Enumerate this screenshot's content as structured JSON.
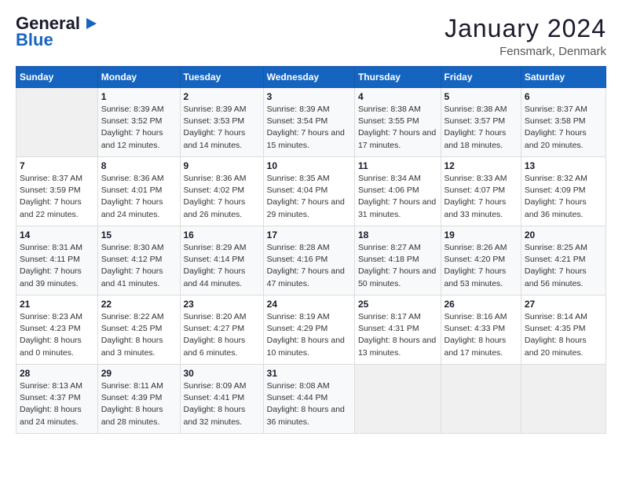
{
  "header": {
    "logo_line1": "General",
    "logo_line2": "Blue",
    "month_title": "January 2024",
    "location": "Fensmark, Denmark"
  },
  "weekdays": [
    "Sunday",
    "Monday",
    "Tuesday",
    "Wednesday",
    "Thursday",
    "Friday",
    "Saturday"
  ],
  "weeks": [
    [
      {
        "num": "",
        "sunrise": "",
        "sunset": "",
        "daylight": ""
      },
      {
        "num": "1",
        "sunrise": "Sunrise: 8:39 AM",
        "sunset": "Sunset: 3:52 PM",
        "daylight": "Daylight: 7 hours and 12 minutes."
      },
      {
        "num": "2",
        "sunrise": "Sunrise: 8:39 AM",
        "sunset": "Sunset: 3:53 PM",
        "daylight": "Daylight: 7 hours and 14 minutes."
      },
      {
        "num": "3",
        "sunrise": "Sunrise: 8:39 AM",
        "sunset": "Sunset: 3:54 PM",
        "daylight": "Daylight: 7 hours and 15 minutes."
      },
      {
        "num": "4",
        "sunrise": "Sunrise: 8:38 AM",
        "sunset": "Sunset: 3:55 PM",
        "daylight": "Daylight: 7 hours and 17 minutes."
      },
      {
        "num": "5",
        "sunrise": "Sunrise: 8:38 AM",
        "sunset": "Sunset: 3:57 PM",
        "daylight": "Daylight: 7 hours and 18 minutes."
      },
      {
        "num": "6",
        "sunrise": "Sunrise: 8:37 AM",
        "sunset": "Sunset: 3:58 PM",
        "daylight": "Daylight: 7 hours and 20 minutes."
      }
    ],
    [
      {
        "num": "7",
        "sunrise": "Sunrise: 8:37 AM",
        "sunset": "Sunset: 3:59 PM",
        "daylight": "Daylight: 7 hours and 22 minutes."
      },
      {
        "num": "8",
        "sunrise": "Sunrise: 8:36 AM",
        "sunset": "Sunset: 4:01 PM",
        "daylight": "Daylight: 7 hours and 24 minutes."
      },
      {
        "num": "9",
        "sunrise": "Sunrise: 8:36 AM",
        "sunset": "Sunset: 4:02 PM",
        "daylight": "Daylight: 7 hours and 26 minutes."
      },
      {
        "num": "10",
        "sunrise": "Sunrise: 8:35 AM",
        "sunset": "Sunset: 4:04 PM",
        "daylight": "Daylight: 7 hours and 29 minutes."
      },
      {
        "num": "11",
        "sunrise": "Sunrise: 8:34 AM",
        "sunset": "Sunset: 4:06 PM",
        "daylight": "Daylight: 7 hours and 31 minutes."
      },
      {
        "num": "12",
        "sunrise": "Sunrise: 8:33 AM",
        "sunset": "Sunset: 4:07 PM",
        "daylight": "Daylight: 7 hours and 33 minutes."
      },
      {
        "num": "13",
        "sunrise": "Sunrise: 8:32 AM",
        "sunset": "Sunset: 4:09 PM",
        "daylight": "Daylight: 7 hours and 36 minutes."
      }
    ],
    [
      {
        "num": "14",
        "sunrise": "Sunrise: 8:31 AM",
        "sunset": "Sunset: 4:11 PM",
        "daylight": "Daylight: 7 hours and 39 minutes."
      },
      {
        "num": "15",
        "sunrise": "Sunrise: 8:30 AM",
        "sunset": "Sunset: 4:12 PM",
        "daylight": "Daylight: 7 hours and 41 minutes."
      },
      {
        "num": "16",
        "sunrise": "Sunrise: 8:29 AM",
        "sunset": "Sunset: 4:14 PM",
        "daylight": "Daylight: 7 hours and 44 minutes."
      },
      {
        "num": "17",
        "sunrise": "Sunrise: 8:28 AM",
        "sunset": "Sunset: 4:16 PM",
        "daylight": "Daylight: 7 hours and 47 minutes."
      },
      {
        "num": "18",
        "sunrise": "Sunrise: 8:27 AM",
        "sunset": "Sunset: 4:18 PM",
        "daylight": "Daylight: 7 hours and 50 minutes."
      },
      {
        "num": "19",
        "sunrise": "Sunrise: 8:26 AM",
        "sunset": "Sunset: 4:20 PM",
        "daylight": "Daylight: 7 hours and 53 minutes."
      },
      {
        "num": "20",
        "sunrise": "Sunrise: 8:25 AM",
        "sunset": "Sunset: 4:21 PM",
        "daylight": "Daylight: 7 hours and 56 minutes."
      }
    ],
    [
      {
        "num": "21",
        "sunrise": "Sunrise: 8:23 AM",
        "sunset": "Sunset: 4:23 PM",
        "daylight": "Daylight: 8 hours and 0 minutes."
      },
      {
        "num": "22",
        "sunrise": "Sunrise: 8:22 AM",
        "sunset": "Sunset: 4:25 PM",
        "daylight": "Daylight: 8 hours and 3 minutes."
      },
      {
        "num": "23",
        "sunrise": "Sunrise: 8:20 AM",
        "sunset": "Sunset: 4:27 PM",
        "daylight": "Daylight: 8 hours and 6 minutes."
      },
      {
        "num": "24",
        "sunrise": "Sunrise: 8:19 AM",
        "sunset": "Sunset: 4:29 PM",
        "daylight": "Daylight: 8 hours and 10 minutes."
      },
      {
        "num": "25",
        "sunrise": "Sunrise: 8:17 AM",
        "sunset": "Sunset: 4:31 PM",
        "daylight": "Daylight: 8 hours and 13 minutes."
      },
      {
        "num": "26",
        "sunrise": "Sunrise: 8:16 AM",
        "sunset": "Sunset: 4:33 PM",
        "daylight": "Daylight: 8 hours and 17 minutes."
      },
      {
        "num": "27",
        "sunrise": "Sunrise: 8:14 AM",
        "sunset": "Sunset: 4:35 PM",
        "daylight": "Daylight: 8 hours and 20 minutes."
      }
    ],
    [
      {
        "num": "28",
        "sunrise": "Sunrise: 8:13 AM",
        "sunset": "Sunset: 4:37 PM",
        "daylight": "Daylight: 8 hours and 24 minutes."
      },
      {
        "num": "29",
        "sunrise": "Sunrise: 8:11 AM",
        "sunset": "Sunset: 4:39 PM",
        "daylight": "Daylight: 8 hours and 28 minutes."
      },
      {
        "num": "30",
        "sunrise": "Sunrise: 8:09 AM",
        "sunset": "Sunset: 4:41 PM",
        "daylight": "Daylight: 8 hours and 32 minutes."
      },
      {
        "num": "31",
        "sunrise": "Sunrise: 8:08 AM",
        "sunset": "Sunset: 4:44 PM",
        "daylight": "Daylight: 8 hours and 36 minutes."
      },
      {
        "num": "",
        "sunrise": "",
        "sunset": "",
        "daylight": ""
      },
      {
        "num": "",
        "sunrise": "",
        "sunset": "",
        "daylight": ""
      },
      {
        "num": "",
        "sunrise": "",
        "sunset": "",
        "daylight": ""
      }
    ]
  ]
}
